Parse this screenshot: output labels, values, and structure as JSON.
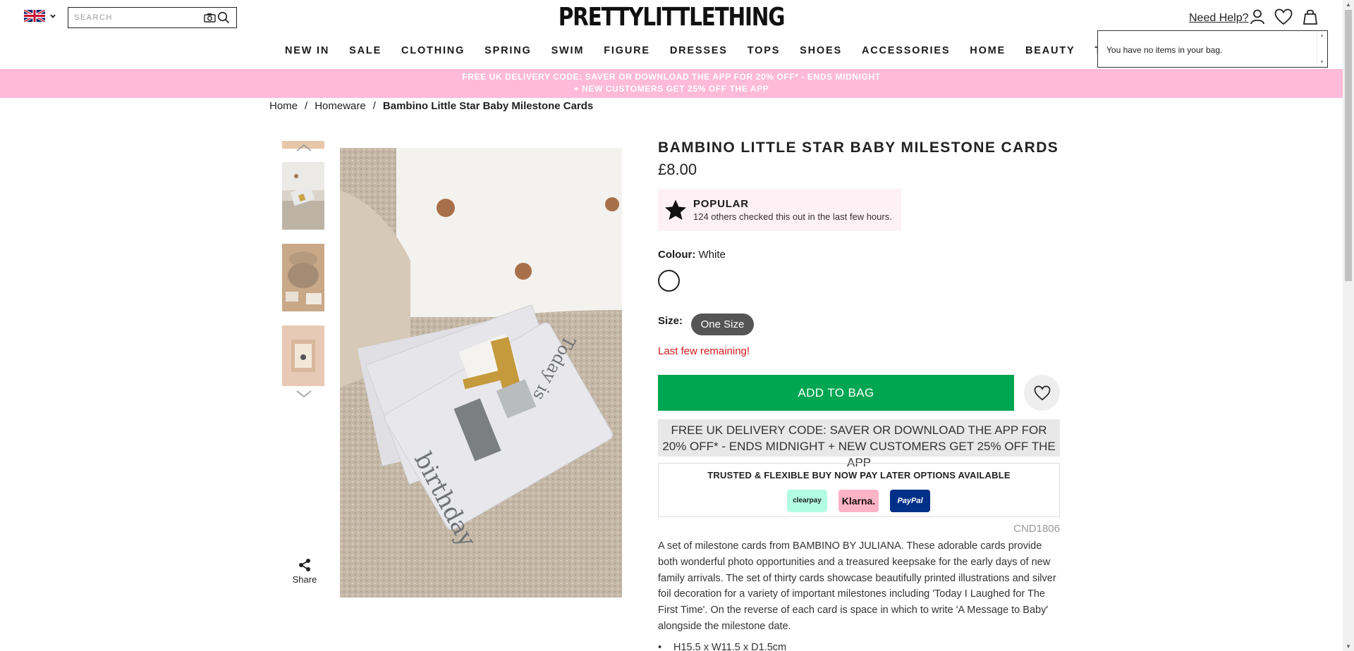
{
  "header": {
    "search_placeholder": "SEARCH",
    "logo": "PRETTYLITTLETHING",
    "need_help": "Need Help?",
    "locale_icon": "uk-flag-icon",
    "icons": [
      "camera-icon",
      "search-icon",
      "account-icon",
      "wishlist-heart-icon",
      "bag-icon"
    ]
  },
  "nav": {
    "items": [
      "NEW IN",
      "SALE",
      "CLOTHING",
      "SPRING",
      "SWIM",
      "FIGURE",
      "DRESSES",
      "TOPS",
      "SHOES",
      "ACCESSORIES",
      "HOME",
      "BEAUTY",
      "THE EDIT"
    ]
  },
  "bag_popup": {
    "text": "You have no items in your bag."
  },
  "promo": {
    "line1": "FREE UK DELIVERY CODE: SAVER OR DOWNLOAD THE APP FOR 20% OFF* - ENDS MIDNIGHT",
    "line2": "+ NEW CUSTOMERS GET 25% OFF THE APP"
  },
  "breadcrumb": {
    "items": [
      "Home",
      "Homeware",
      "Bambino Little Star Baby Milestone Cards"
    ],
    "separator": "/"
  },
  "gallery": {
    "share_label": "Share"
  },
  "product": {
    "title": "BAMBINO LITTLE STAR BABY MILESTONE CARDS",
    "price": "£8.00",
    "popular_title": "POPULAR",
    "popular_text": "124 others checked this out in the last few hours.",
    "colour_label": "Colour:",
    "colour_value": "White",
    "size_label": "Size:",
    "size_value": "One Size",
    "stock_message": "Last few remaining!",
    "add_to_bag": "ADD TO BAG",
    "delivery_banner": "FREE UK DELIVERY CODE: SAVER OR DOWNLOAD THE APP FOR 20% OFF* - ENDS MIDNIGHT + NEW CUSTOMERS GET 25% OFF THE APP",
    "bnpl_title": "TRUSTED & FLEXIBLE BUY NOW PAY LATER OPTIONS AVAILABLE",
    "bnpl_providers": [
      "clearpay",
      "Klarna.",
      "PayPal"
    ],
    "product_code": "CND1806",
    "description": "A set of milestone cards from BAMBINO BY JULIANA. These adorable cards provide both wonderful photo opportunities and a treasured keepsake for the early days of new family arrivals. The set of thirty cards showcase beautifully printed illustrations and silver foil decoration for a variety of important milestones including 'Today I Laughed for The First Time'. On the reverse of each card is space in which to write 'A Message to Baby' alongside the milestone date.",
    "bullet_1": "H15.5 x W11.5 x D1.5cm"
  },
  "colors": {
    "promo_pink": "#ffbad9",
    "add_to_bag_green": "#00a651",
    "stock_red": "#d01c1c"
  }
}
